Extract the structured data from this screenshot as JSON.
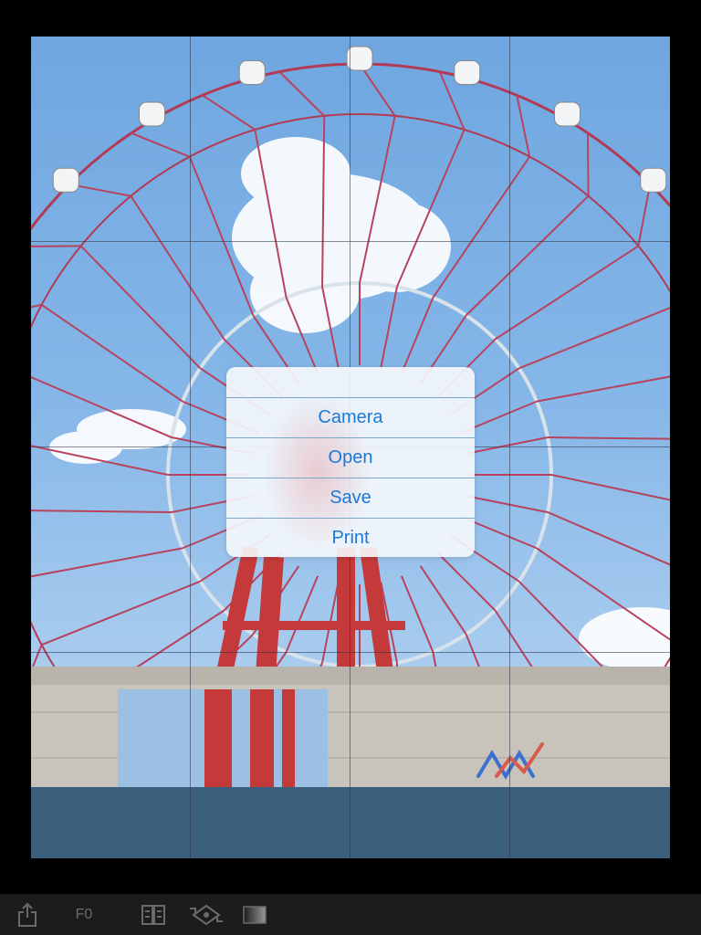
{
  "photo": {
    "description_icon": "photo-canvas",
    "grid": {
      "columns": 4,
      "rows": 4
    }
  },
  "menu": {
    "items": [
      {
        "id": "camera",
        "label": "Camera"
      },
      {
        "id": "open",
        "label": "Open"
      },
      {
        "id": "save",
        "label": "Save"
      },
      {
        "id": "print",
        "label": "Print"
      }
    ],
    "accent_color": "#1a7ad8"
  },
  "toolbar": {
    "share_icon": "share-icon",
    "filter_label": "F0",
    "compare_icon": "compare-icon",
    "transform_icon": "transform-icon",
    "gradient_icon": "gradient-icon"
  }
}
